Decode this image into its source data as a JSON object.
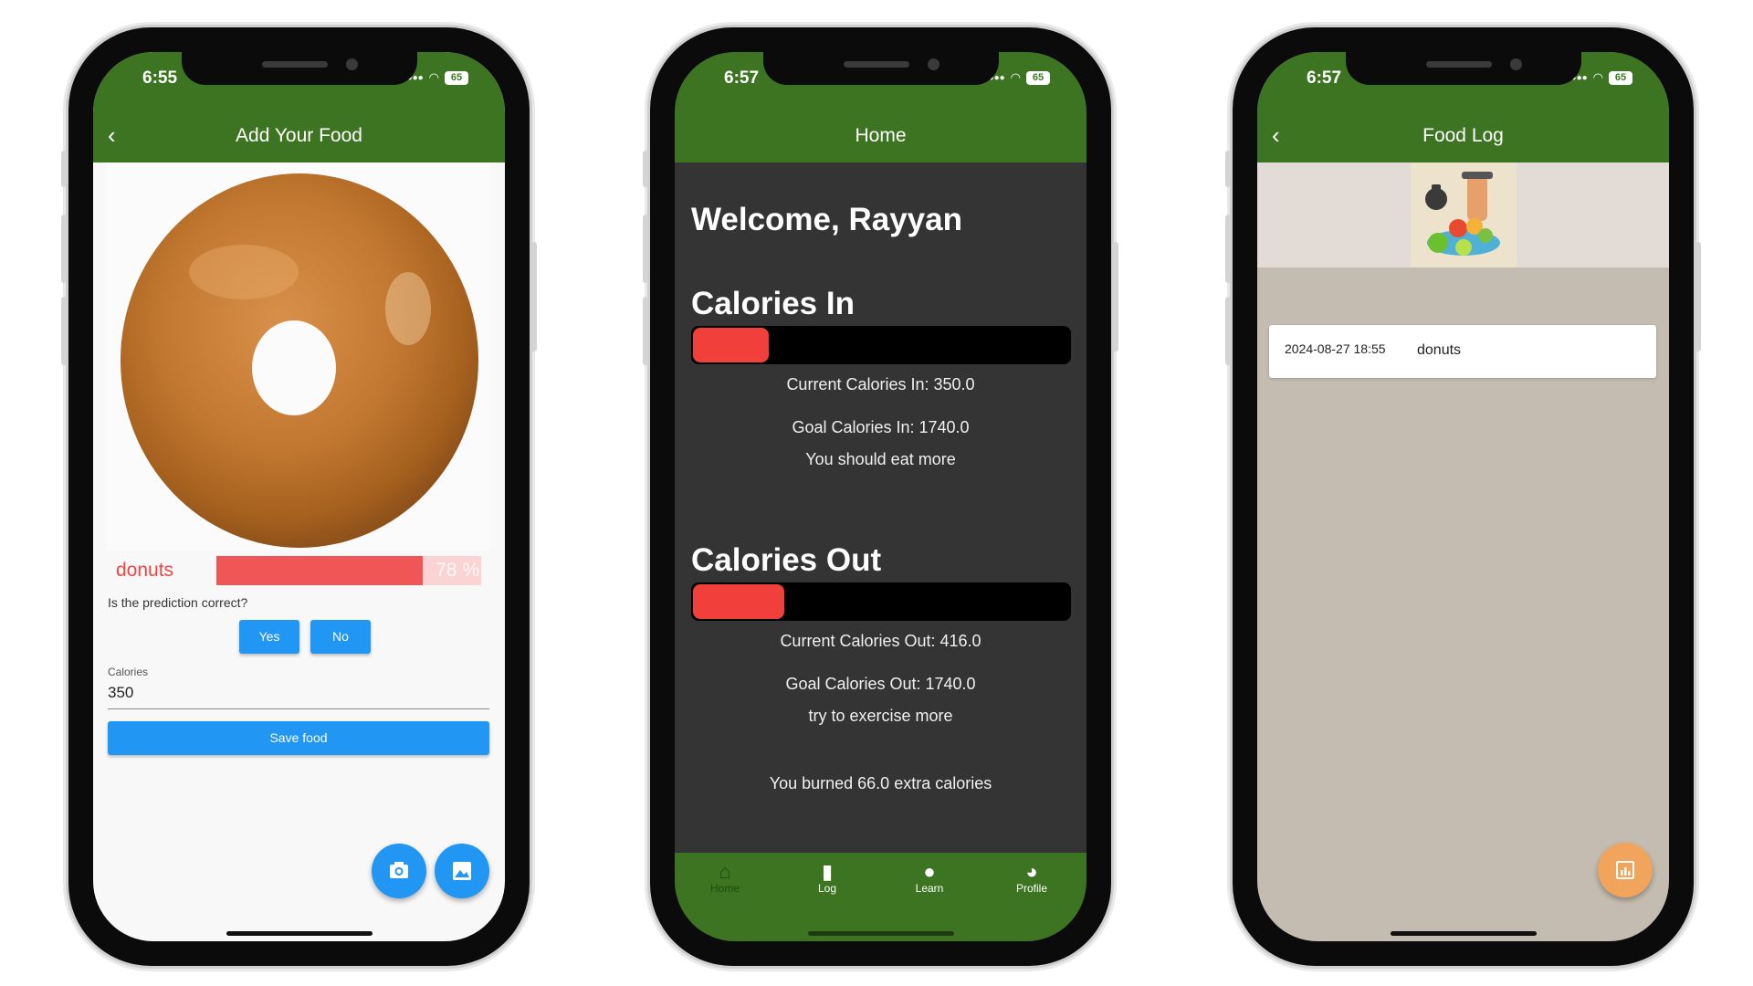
{
  "screen1": {
    "status_time": "6:55",
    "battery": "65",
    "title": "Add Your Food",
    "prediction_label": "donuts",
    "prediction_percent": "78 %",
    "prediction_confidence": 0.78,
    "question": "Is the prediction correct?",
    "yes_label": "Yes",
    "no_label": "No",
    "calories_label": "Calories",
    "calories_value": "350",
    "save_label": "Save food"
  },
  "screen2": {
    "status_time": "6:57",
    "battery": "65",
    "title": "Home",
    "welcome": "Welcome, Rayyan",
    "calories_in_title": "Calories In",
    "calories_in_progress": 0.2,
    "current_in": "Current Calories In: 350.0",
    "goal_in": "Goal Calories In: 1740.0",
    "in_message": "You should eat more",
    "calories_out_title": "Calories Out",
    "calories_out_progress": 0.24,
    "current_out": "Current Calories Out: 416.0",
    "goal_out": "Goal Calories Out: 1740.0",
    "out_message": "try to exercise more",
    "burned_message": "You burned 66.0 extra calories",
    "nav": [
      {
        "label": "Home",
        "icon": "home-icon"
      },
      {
        "label": "Log",
        "icon": "book-icon"
      },
      {
        "label": "Learn",
        "icon": "lightbulb-icon"
      },
      {
        "label": "Profile",
        "icon": "person-icon"
      }
    ]
  },
  "screen3": {
    "status_time": "6:57",
    "battery": "65",
    "title": "Food Log",
    "entries": [
      {
        "date": "2024-08-27 18:55",
        "name": "donuts"
      }
    ]
  },
  "colors": {
    "appbar_green": "#3d7421",
    "accent_blue": "#2196f3",
    "progress_red": "#f1403b",
    "fab_orange": "#f0a45c"
  }
}
